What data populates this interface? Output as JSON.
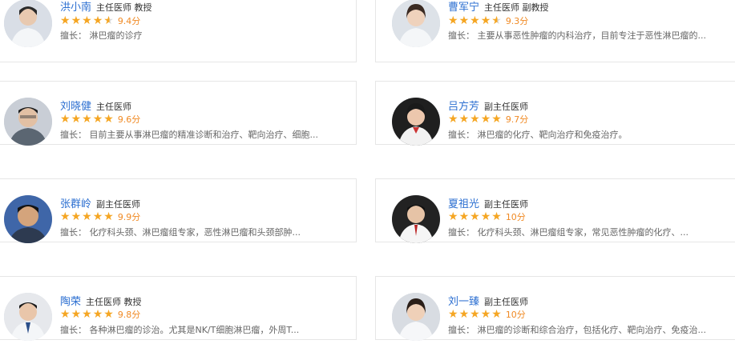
{
  "doctors": [
    {
      "name": "洪小南",
      "title": "主任医师 教授",
      "stars": 4.5,
      "score": "9.4分",
      "specialty": "擅长： 淋巴瘤的诊疗"
    },
    {
      "name": "曹军宁",
      "title": "主任医师 副教授",
      "stars": 4.5,
      "score": "9.3分",
      "specialty": "擅长： 主要从事恶性肿瘤的内科治疗，目前专注于恶性淋巴瘤的..."
    },
    {
      "name": "刘晓健",
      "title": "主任医师",
      "stars": 5,
      "score": "9.6分",
      "specialty": "擅长： 目前主要从事淋巴瘤的精准诊断和治疗、靶向治疗、细胞..."
    },
    {
      "name": "吕方芳",
      "title": "副主任医师",
      "stars": 5,
      "score": "9.7分",
      "specialty": "擅长： 淋巴瘤的化疗、靶向治疗和免疫治疗。"
    },
    {
      "name": "张群岭",
      "title": "副主任医师",
      "stars": 5,
      "score": "9.9分",
      "specialty": "擅长： 化疗科头颈、淋巴瘤组专家，恶性淋巴瘤和头颈部肿..."
    },
    {
      "name": "夏祖光",
      "title": "副主任医师",
      "stars": 5,
      "score": "10分",
      "specialty": "擅长： 化疗科头颈、淋巴瘤组专家，常见恶性肿瘤的化疗、..."
    },
    {
      "name": "陶荣",
      "title": "主任医师 教授",
      "stars": 5,
      "score": "9.8分",
      "specialty": "擅长： 各种淋巴瘤的诊治。尤其是NK/T细胞淋巴瘤，外周T..."
    },
    {
      "name": "刘一臻",
      "title": "副主任医师",
      "stars": 5,
      "score": "10分",
      "specialty": "擅长： 淋巴瘤的诊断和综合治疗，包括化疗、靶向治疗、免疫治..."
    }
  ]
}
